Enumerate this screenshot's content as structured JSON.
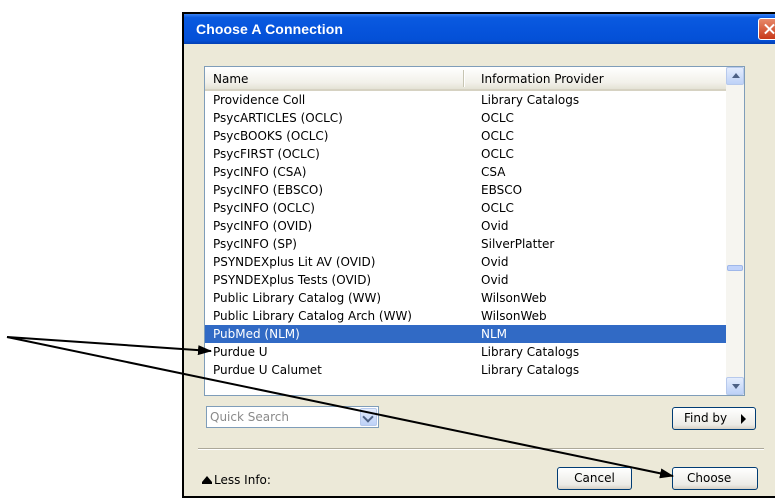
{
  "dialog": {
    "title": "Choose A Connection",
    "close_icon": "close-icon"
  },
  "list": {
    "columns": [
      "Name",
      "Information Provider"
    ],
    "selected_row": "PubMed (NLM)",
    "rows": [
      {
        "name": "Providence Coll",
        "provider": "Library Catalogs"
      },
      {
        "name": "PsycARTICLES (OCLC)",
        "provider": "OCLC"
      },
      {
        "name": "PsycBOOKS (OCLC)",
        "provider": "OCLC"
      },
      {
        "name": "PsycFIRST (OCLC)",
        "provider": "OCLC"
      },
      {
        "name": "PsycINFO (CSA)",
        "provider": "CSA"
      },
      {
        "name": "PsycINFO (EBSCO)",
        "provider": "EBSCO"
      },
      {
        "name": "PsycINFO (OCLC)",
        "provider": "OCLC"
      },
      {
        "name": "PsycINFO (OVID)",
        "provider": "Ovid"
      },
      {
        "name": "PsycINFO (SP)",
        "provider": "SilverPlatter"
      },
      {
        "name": "PSYNDEXplus Lit AV (OVID)",
        "provider": "Ovid"
      },
      {
        "name": "PSYNDEXplus Tests (OVID)",
        "provider": "Ovid"
      },
      {
        "name": "Public Library Catalog (WW)",
        "provider": "WilsonWeb"
      },
      {
        "name": "Public Library Catalog Arch (WW)",
        "provider": "WilsonWeb"
      },
      {
        "name": "PubMed (NLM)",
        "provider": "NLM"
      },
      {
        "name": "Purdue U",
        "provider": "Library Catalogs"
      },
      {
        "name": "Purdue U Calumet",
        "provider": "Library Catalogs"
      }
    ]
  },
  "quick_search": {
    "placeholder": "Quick Search"
  },
  "buttons": {
    "find_by": "Find by",
    "cancel": "Cancel",
    "choose": "Choose"
  },
  "less_info": "Less Info:",
  "colors": {
    "titlebar": "#0654dc",
    "selection": "#316ac5",
    "dialog_bg": "#ece9d8"
  }
}
